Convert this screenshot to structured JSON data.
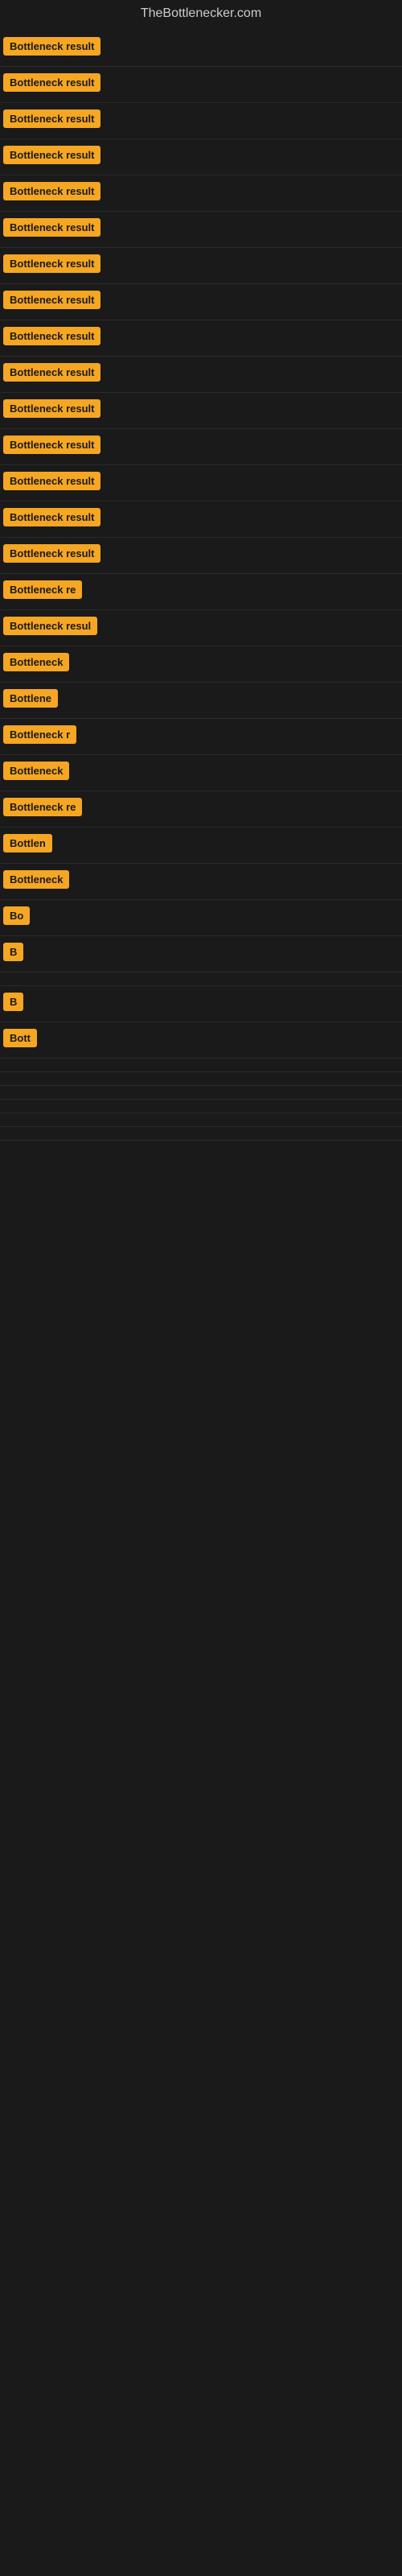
{
  "site": {
    "title": "TheBottlenecker.com"
  },
  "items": [
    {
      "label": "Bottleneck result",
      "width": 148
    },
    {
      "label": "Bottleneck result",
      "width": 148
    },
    {
      "label": "Bottleneck result",
      "width": 148
    },
    {
      "label": "Bottleneck result",
      "width": 148
    },
    {
      "label": "Bottleneck result",
      "width": 148
    },
    {
      "label": "Bottleneck result",
      "width": 148
    },
    {
      "label": "Bottleneck result",
      "width": 148
    },
    {
      "label": "Bottleneck result",
      "width": 148
    },
    {
      "label": "Bottleneck result",
      "width": 148
    },
    {
      "label": "Bottleneck result",
      "width": 148
    },
    {
      "label": "Bottleneck result",
      "width": 148
    },
    {
      "label": "Bottleneck result",
      "width": 148
    },
    {
      "label": "Bottleneck result",
      "width": 148
    },
    {
      "label": "Bottleneck result",
      "width": 148
    },
    {
      "label": "Bottleneck result",
      "width": 148
    },
    {
      "label": "Bottleneck re",
      "width": 110
    },
    {
      "label": "Bottleneck resul",
      "width": 128
    },
    {
      "label": "Bottleneck",
      "width": 88
    },
    {
      "label": "Bottlene",
      "width": 70
    },
    {
      "label": "Bottleneck r",
      "width": 98
    },
    {
      "label": "Bottleneck",
      "width": 82
    },
    {
      "label": "Bottleneck re",
      "width": 105
    },
    {
      "label": "Bottlen",
      "width": 65
    },
    {
      "label": "Bottleneck",
      "width": 84
    },
    {
      "label": "Bo",
      "width": 28
    },
    {
      "label": "B",
      "width": 14
    },
    {
      "label": "",
      "width": 0
    },
    {
      "label": "B",
      "width": 10
    },
    {
      "label": "Bott",
      "width": 38
    },
    {
      "label": "",
      "width": 0
    },
    {
      "label": "",
      "width": 0
    },
    {
      "label": "",
      "width": 0
    },
    {
      "label": "",
      "width": 0
    },
    {
      "label": "",
      "width": 0
    },
    {
      "label": "",
      "width": 0
    }
  ]
}
